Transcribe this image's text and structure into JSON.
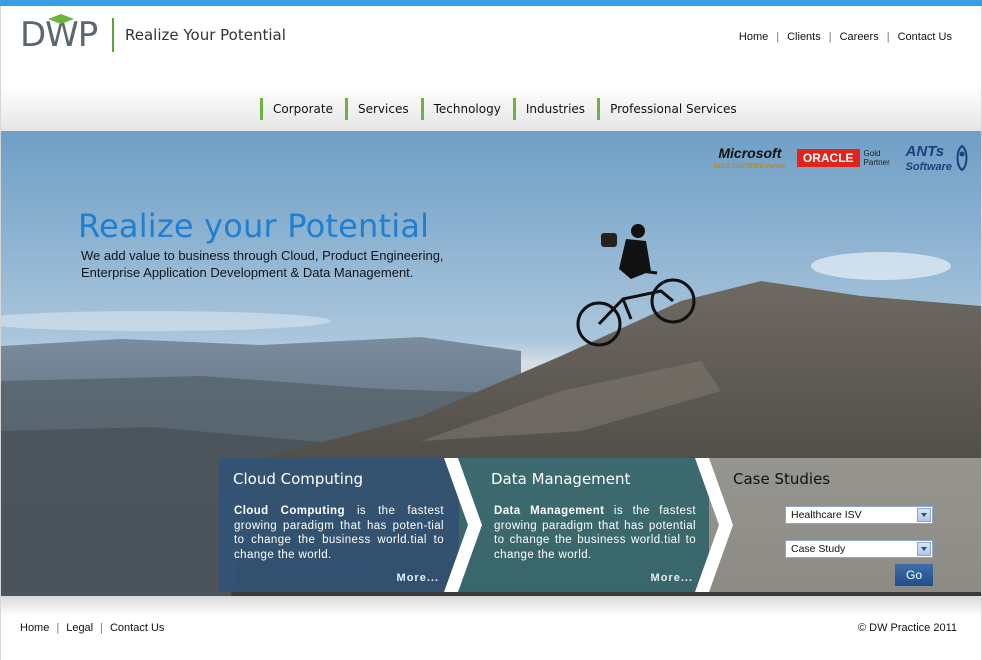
{
  "header": {
    "logo_text": "DWP",
    "tagline": "Realize Your Potential",
    "top_nav": [
      "Home",
      "Clients",
      "Careers",
      "Contact Us"
    ]
  },
  "main_nav": [
    "Corporate",
    "Services",
    "Technology",
    "Industries",
    "Professional Services"
  ],
  "hero": {
    "title": "Realize your Potential",
    "subtitle": "We add value to business through Cloud, Product Engineering, Enterprise Application Development & Data Management.",
    "partners": {
      "microsoft": "Microsoft",
      "microsoft_sub": "GOLD CERTIFIED Partner",
      "oracle": "ORACLE",
      "oracle_sub": "Gold Partner",
      "ants": "ANTs",
      "ants_sub": "Software"
    }
  },
  "panels": {
    "cloud": {
      "title": "Cloud Computing",
      "bold": "Cloud Computing",
      "text": " is the fastest growing paradigm that has poten-tial to change the business world.tial to change the world.",
      "more": "More..."
    },
    "data": {
      "title": "Data Management",
      "bold": "Data Management",
      "text": " is the fastest growing paradigm that has potential to change the business world.tial to change the world.",
      "more": "More..."
    },
    "case": {
      "title": "Case Studies",
      "select1": "Healthcare ISV",
      "select2": "Case Study",
      "go": "Go"
    }
  },
  "footer": {
    "links": [
      "Home",
      "Legal",
      "Contact Us"
    ],
    "copyright": "© DW Practice 2011"
  },
  "colors": {
    "accent_blue": "#3a9ee4",
    "nav_green": "#6cb33f",
    "hero_title": "#1f7fd1"
  }
}
